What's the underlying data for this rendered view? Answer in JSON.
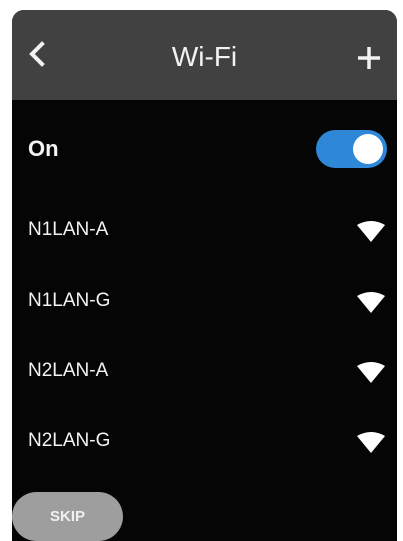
{
  "header": {
    "title": "Wi-Fi",
    "back_icon": "chevron-left-icon",
    "add_icon": "plus-icon"
  },
  "wifi_toggle": {
    "label": "On",
    "state": "on",
    "accent_color": "#2f87d8"
  },
  "networks": [
    {
      "ssid": "N1LAN-A",
      "icon": "wifi-signal-icon"
    },
    {
      "ssid": "N1LAN-G",
      "icon": "wifi-signal-icon"
    },
    {
      "ssid": "N2LAN-A",
      "icon": "wifi-signal-icon"
    },
    {
      "ssid": "N2LAN-G",
      "icon": "wifi-signal-icon"
    }
  ],
  "footer": {
    "skip_label": "SKIP"
  }
}
